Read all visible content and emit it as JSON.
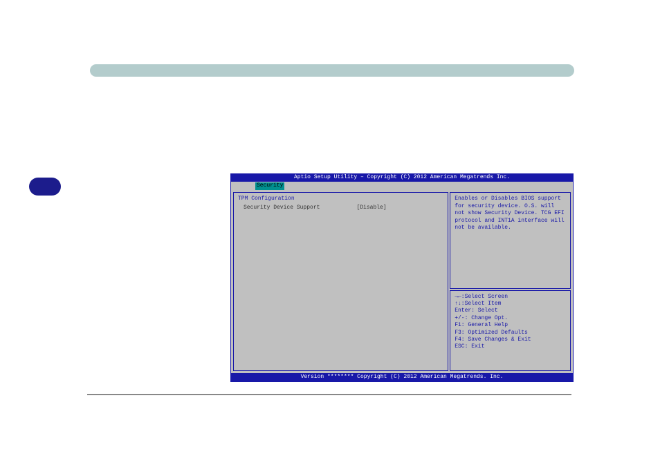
{
  "bios": {
    "title": "Aptio Setup Utility – Copyright (C) 2012 American Megatrends Inc.",
    "tab": "Security",
    "heading": "TPM Configuration",
    "setting": {
      "label": "Security Device Support",
      "value": "[Disable]"
    },
    "help": "Enables or Disables BIOS support for security device. O.S. will not show Security Device. TCG EFI protocol and INT1A interface will not be available.",
    "nav": {
      "l1": "→←:Select Screen",
      "l2": "↑↓:Select Item",
      "l3": "Enter: Select",
      "l4": "+/-: Change Opt.",
      "l5": "F1: General Help",
      "l6": "F3: Optimized Defaults",
      "l7": "F4: Save Changes & Exit",
      "l8": "ESC: Exit"
    },
    "footer": "Version ******** Copyright (C) 2012 American Megatrends.  Inc."
  }
}
